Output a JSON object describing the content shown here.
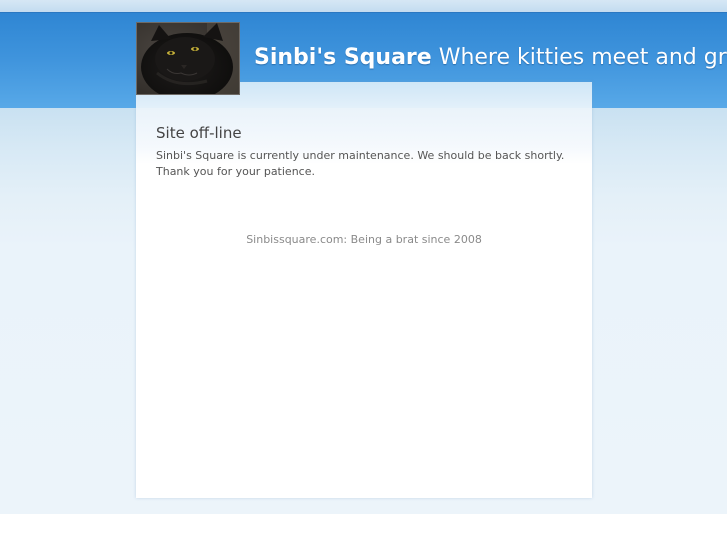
{
  "header": {
    "site_name": "Sinbi's Square",
    "slogan": "Where kitties meet and greet",
    "logo_icon": "cat-photo-icon"
  },
  "main": {
    "title": "Site off-line",
    "message": "Sinbi's Square is currently under maintenance. We should be back shortly. Thank you for your patience."
  },
  "footer": {
    "text": "Sinbissquare.com: Being a brat since 2008"
  },
  "colors": {
    "header_blue": "#3e93dc",
    "background_light_blue": "#eaf3fa",
    "panel_white": "#ffffff",
    "title_text": "#444444",
    "body_text": "#555555",
    "footer_text": "#8a8a8a"
  }
}
